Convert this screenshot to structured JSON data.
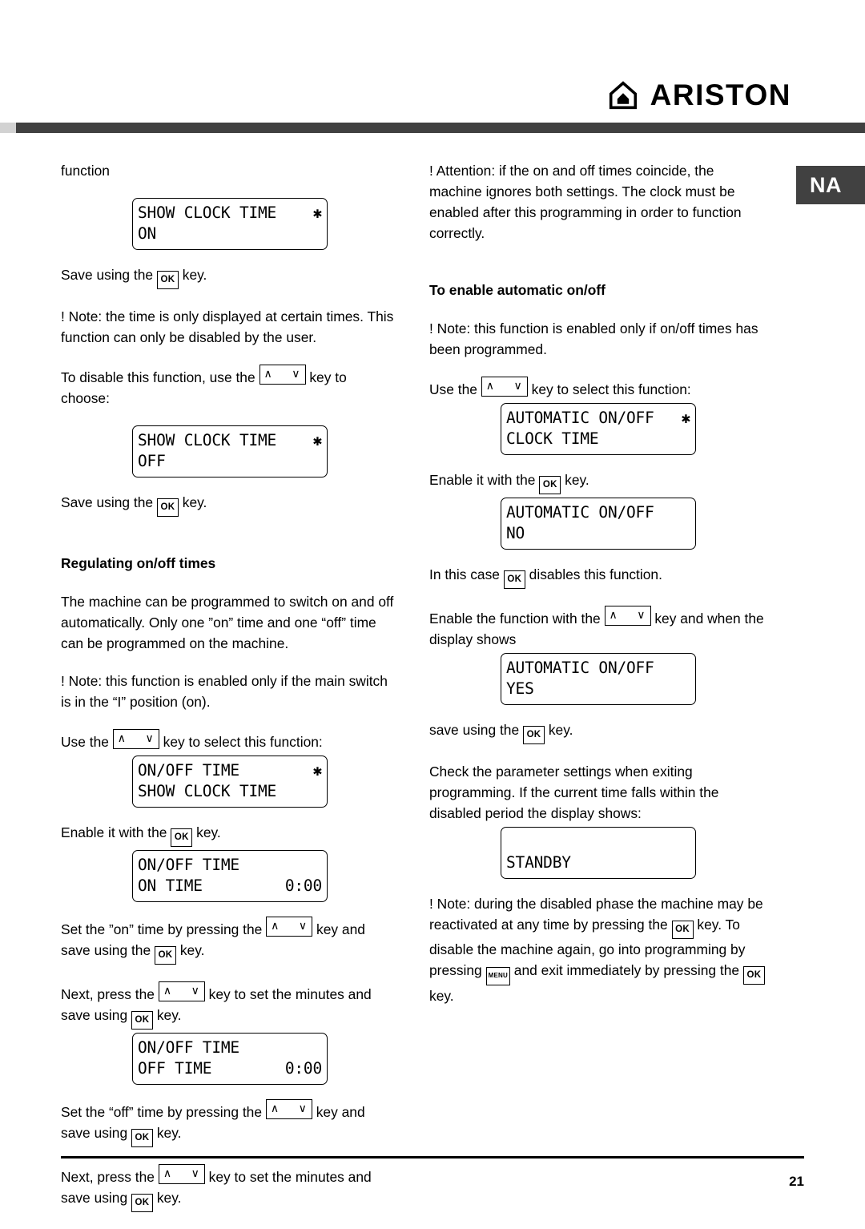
{
  "header": {
    "brand_name": "ARISTON",
    "brand_mark_icon": "house-icon"
  },
  "section_badge": {
    "label": "NA"
  },
  "footer": {
    "page_number": "21"
  },
  "keys": {
    "ok": "OK",
    "menu": "MENU",
    "up": "∧",
    "down": "∨"
  },
  "left_column": {
    "p_function": "function",
    "lcd_show_clock_on": {
      "line1": "SHOW CLOCK TIME",
      "line1_right": "✱",
      "line2": "ON",
      "line2_right": ""
    },
    "p_save_1a": "Save using the",
    "p_save_1b": "key.",
    "p_note_time": "! Note: the time is only displayed at certain times. This function can only be disabled by the user.",
    "p_disable_a": "To disable this function, use the",
    "p_disable_b": "key to choose:",
    "lcd_show_clock_off": {
      "line1": "SHOW CLOCK TIME",
      "line1_right": "✱",
      "line2": "OFF",
      "line2_right": ""
    },
    "p_save_2a": "Save using the",
    "p_save_2b": "key.",
    "h_regulating": "Regulating on/off times",
    "p_machine": "The machine can be programmed to switch on and off automatically. Only one ”on” time and one “off” time can be programmed on the machine.",
    "p_note_main_switch": "! Note: this function is enabled only if the main switch is in the “I” position (on).",
    "p_use_select_a": "Use the",
    "p_use_select_b": "key to select this function:",
    "lcd_onoff_show": {
      "line1": "ON/OFF TIME",
      "line1_right": "✱",
      "line2": "SHOW CLOCK TIME",
      "line2_right": ""
    },
    "p_enable_a": "Enable it with the",
    "p_enable_b": "key.",
    "lcd_on_time": {
      "line1": "ON/OFF TIME",
      "line1_right": "",
      "line2": "ON TIME",
      "line2_right": "0:00"
    },
    "p_set_on_a": "Set the ”on” time by pressing the",
    "p_set_on_b": "key and save using the",
    "p_set_on_c": "key.",
    "p_next_on_a": "Next, press the",
    "p_next_on_b": "key to set the minutes and save using",
    "p_next_on_c": "key.",
    "lcd_off_time": {
      "line1": "ON/OFF TIME",
      "line1_right": "",
      "line2": "OFF TIME",
      "line2_right": "0:00"
    },
    "p_set_off_a": "Set the “off” time by pressing the",
    "p_set_off_b": "key and save using",
    "p_set_off_c": "key.",
    "p_next_off_a": "Next, press the",
    "p_next_off_b": "key to set the minutes and save using",
    "p_next_off_c": "key."
  },
  "right_column": {
    "p_attention": "! Attention: if the on and off times coincide, the machine ignores both settings. The clock must be enabled after this programming in order to function correctly.",
    "h_enable_auto": "To enable automatic on/off",
    "p_note_programmed": "! Note: this function is enabled only if on/off times has been programmed.",
    "p_use_select_a": "Use the",
    "p_use_select_b": "key to select this function:",
    "lcd_auto_clock": {
      "line1": "AUTOMATIC ON/OFF",
      "line1_right": "✱",
      "line2": "CLOCK TIME",
      "line2_right": ""
    },
    "p_enable_a": "Enable it with the",
    "p_enable_b": "key.",
    "lcd_auto_no": {
      "line1": "AUTOMATIC ON/OFF",
      "line1_right": "",
      "line2": "NO",
      "line2_right": ""
    },
    "p_in_this_case_a": "In this case",
    "p_in_this_case_b": "disables this function.",
    "p_enable_fn_a": "Enable the function with the",
    "p_enable_fn_b": "key and when the display shows",
    "lcd_auto_yes": {
      "line1": "AUTOMATIC ON/OFF",
      "line1_right": "",
      "line2": "YES",
      "line2_right": ""
    },
    "p_save_a": "save using the",
    "p_save_b": "key.",
    "p_check": "Check the parameter settings when exiting programming. If the current time falls within the disabled period the display shows:",
    "lcd_standby": {
      "line1": "",
      "line1_right": "",
      "line2": "STANDBY",
      "line2_right": ""
    },
    "p_note_disabled_a": "! Note: during the disabled phase the machine may be reactivated at any time by pressing the",
    "p_note_disabled_b": "key. To disable the machine again, go into programming by pressing",
    "p_note_disabled_c": "and exit immediately by pressing the",
    "p_note_disabled_d": "key."
  }
}
